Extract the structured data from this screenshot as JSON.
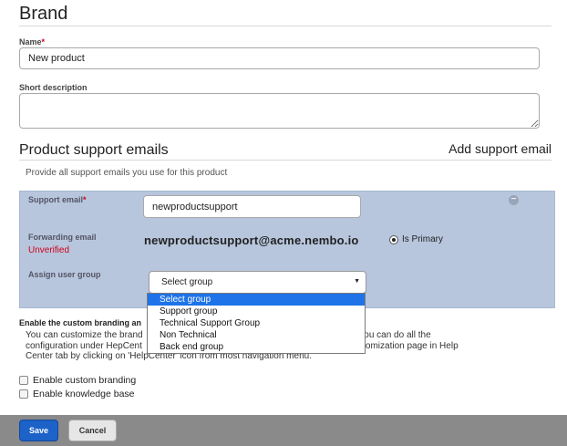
{
  "page": {
    "title": "Brand"
  },
  "name_field": {
    "label": "Name",
    "required_mark": "*",
    "value": "New product"
  },
  "description_field": {
    "label": "Short description",
    "value": ""
  },
  "support_emails": {
    "title": "Product support emails",
    "add_label": "Add support email",
    "hint": "Provide all support emails you use for this product",
    "support_email_label": "Support email",
    "required_mark": "*",
    "support_email_value": "newproductsupport",
    "forwarding_label": "Forwarding email",
    "verification_status": "Unverified",
    "forwarding_address": "newproductsupport@acme.nembo.io",
    "primary_label": "Is Primary",
    "assign_group_label": "Assign user group",
    "group_select_value": "Select group",
    "group_options": [
      "Select group",
      "Support group",
      "Technical Support Group",
      "Non Technical",
      "Back end group"
    ]
  },
  "branding": {
    "heading": "Enable the custom branding an",
    "lines": [
      "You can customize the brand",
      "flag. You can do all the",
      "configuration under HepCent",
      "ct customization page in Help",
      "Center tab by clicking on 'HelpCenter' icon from most navigation menu."
    ]
  },
  "options": {
    "custom_branding": "Enable custom branding",
    "knowledge_base": "Enable knowledge base"
  },
  "footer": {
    "save_label": "Save",
    "cancel_label": "Cancel"
  },
  "colors": {
    "panel": "#b7c6dd",
    "save": "#1d62c8",
    "required": "#d0021b",
    "selected_option": "#1e73e8"
  }
}
